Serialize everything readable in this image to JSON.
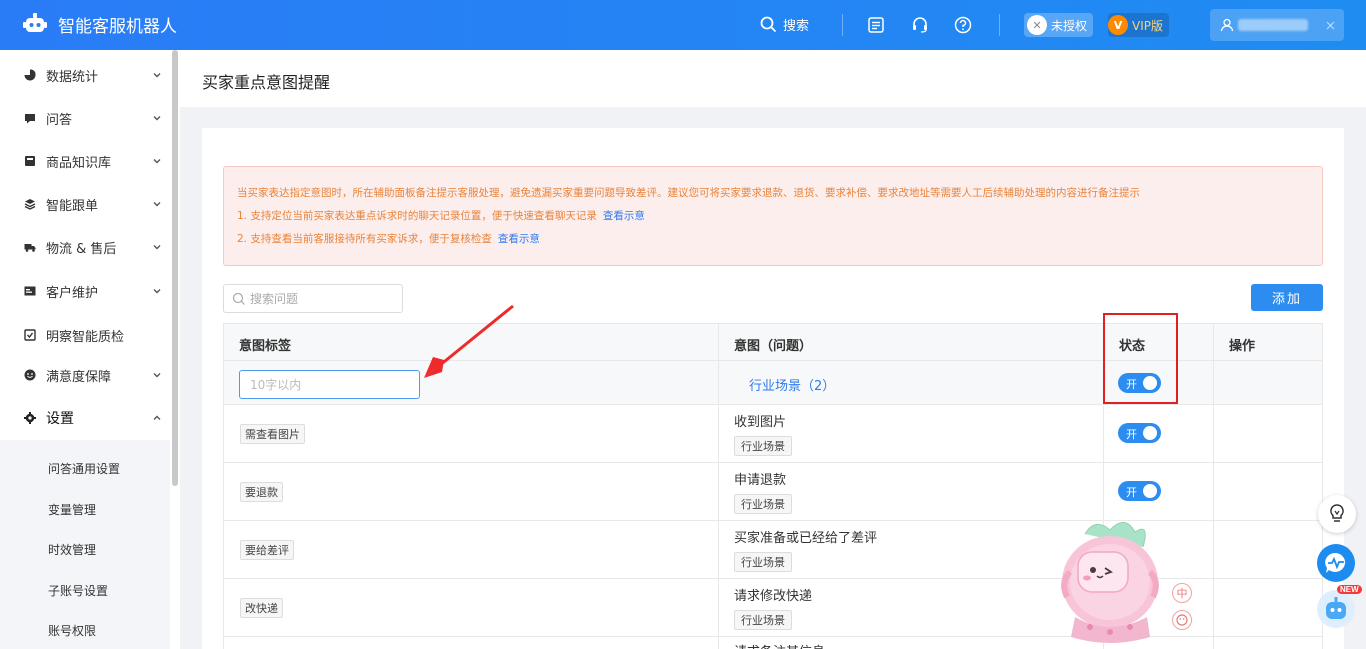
{
  "app": {
    "title": "智能客服机器人"
  },
  "topbar": {
    "search_label": "搜索",
    "unauthorized_label": "未授权",
    "vip_label": "VIP版",
    "icons": [
      "search-icon",
      "checklist-icon",
      "headset-icon",
      "help-icon",
      "user-icon"
    ]
  },
  "sidebar": {
    "items": [
      {
        "label": "数据统计",
        "icon": "pie-chart-icon"
      },
      {
        "label": "问答",
        "icon": "chat-icon"
      },
      {
        "label": "商品知识库",
        "icon": "database-icon"
      },
      {
        "label": "智能跟单",
        "icon": "layers-icon"
      },
      {
        "label": "物流 & 售后",
        "icon": "truck-icon"
      },
      {
        "label": "客户维护",
        "icon": "card-icon"
      },
      {
        "label": "明察智能质检",
        "icon": "inspect-icon"
      },
      {
        "label": "满意度保障",
        "icon": "smile-icon"
      },
      {
        "label": "设置",
        "icon": "gear-icon"
      }
    ],
    "submenu": [
      "问答通用设置",
      "变量管理",
      "时效管理",
      "子账号设置",
      "账号权限"
    ]
  },
  "page": {
    "title": "买家重点意图提醒"
  },
  "notice": {
    "line1": "当买家表达指定意图时，所在辅助面板备注提示客服处理，避免遗漏买家重要问题导致差评。建议您可将买家要求退款、退货、要求补偿、要求改地址等需要人工后续辅助处理的内容进行备注提示",
    "line2": "1. 支持定位当前买家表达重点诉求时的聊天记录位置，便于快速查看聊天记录",
    "line3": "2. 支持查看当前客服接待所有买家诉求，便于复核检查",
    "link_label": "查看示意"
  },
  "search": {
    "placeholder": "搜索问题",
    "value": ""
  },
  "add_button": "添加",
  "table": {
    "headers": [
      "意图标签",
      "意图（问题）",
      "状态",
      "操作"
    ],
    "edit_row": {
      "placeholder": "10字以内",
      "scene_link": "行业场景（2）",
      "status": "开"
    },
    "rows": [
      {
        "tag": "需查看图片",
        "intent": "收到图片",
        "scene": "行业场景",
        "status": "开"
      },
      {
        "tag": "要退款",
        "intent": "申请退款",
        "scene": "行业场景",
        "status": "开"
      },
      {
        "tag": "要给差评",
        "intent": "买家准备或已经给了差评",
        "scene": "行业场景",
        "status": ""
      },
      {
        "tag": "改快递",
        "intent": "请求修改快递",
        "scene": "行业场景",
        "status": ""
      },
      {
        "tag": "",
        "intent": "请求备注其信息",
        "scene": "",
        "status": ""
      }
    ]
  },
  "floating": {
    "new_badge": "NEW",
    "zh_badge": "中"
  },
  "colors": {
    "primary": "#2d8cf0",
    "topbar": "#2a7cf6",
    "notice_text": "#e8843a",
    "highlight": "#e02020"
  }
}
